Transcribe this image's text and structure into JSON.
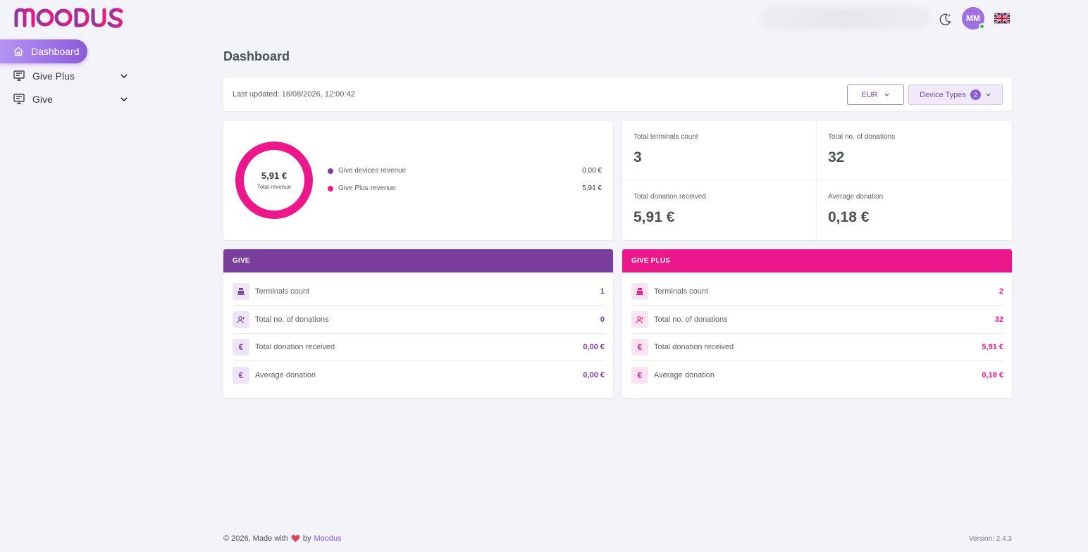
{
  "brand": {
    "logo_text": "MOODUS"
  },
  "header": {
    "avatar_initials": "MM"
  },
  "sidebar": {
    "items": [
      {
        "label": "Dashboard",
        "icon": "home-icon",
        "active": true
      },
      {
        "label": "Give Plus",
        "icon": "terminal-icon"
      },
      {
        "label": "Give",
        "icon": "terminal-icon"
      }
    ]
  },
  "page": {
    "title": "Dashboard"
  },
  "filters": {
    "last_updated": "Last updated: 18/08/2026, 12:00:42",
    "currency": "EUR",
    "device_types_label": "Device Types",
    "device_types_count": "2"
  },
  "revenue": {
    "total_value": "5,91 €",
    "total_label": "Total revenue",
    "legend": [
      {
        "label": "Give devices revenue",
        "value": "0,00 €",
        "color": "#7a3e9d",
        "amount": 0.0
      },
      {
        "label": "Give Plus revenue",
        "value": "5,91 €",
        "color": "#ec178a",
        "amount": 5.91
      }
    ]
  },
  "stats": {
    "terminals": {
      "label": "Total terminals count",
      "value": "3"
    },
    "donations": {
      "label": "Total no. of donations",
      "value": "32"
    },
    "received": {
      "label": "Total donation received",
      "value": "5,91 €"
    },
    "average": {
      "label": "Average donation",
      "value": "0,18 €"
    }
  },
  "give": {
    "title": "GIVE",
    "rows": [
      {
        "label": "Terminals count",
        "value": "1"
      },
      {
        "label": "Total no. of donations",
        "value": "0"
      },
      {
        "label": "Total donation received",
        "value": "0,00 €"
      },
      {
        "label": "Average donation",
        "value": "0,00 €"
      }
    ]
  },
  "give_plus": {
    "title": "GIVE PLUS",
    "rows": [
      {
        "label": "Terminals count",
        "value": "2"
      },
      {
        "label": "Total no. of donations",
        "value": "32"
      },
      {
        "label": "Total donation received",
        "value": "5,91 €"
      },
      {
        "label": "Average donation",
        "value": "0,18 €"
      }
    ]
  },
  "icons": {
    "currency_symbol": "€"
  },
  "footer": {
    "copyright": "© 2026, Made with",
    "by": "by",
    "brand_link": "Moodus",
    "version": "Version: 2.4.3"
  },
  "colors": {
    "accent": "#8b5bd8",
    "give": "#7a3e9d",
    "give_plus": "#ec178a"
  }
}
